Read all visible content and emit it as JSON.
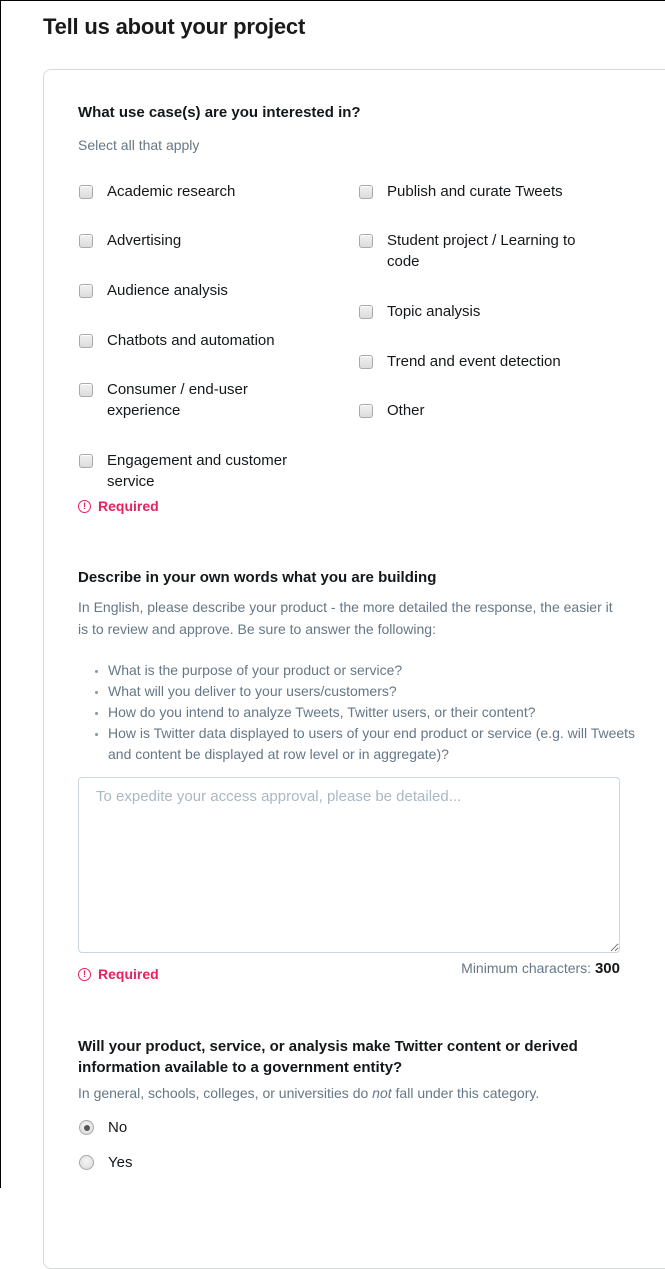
{
  "page": {
    "title": "Tell us about your project"
  },
  "use_cases": {
    "question": "What use case(s) are you interested in?",
    "hint": "Select all that apply",
    "left_options": [
      {
        "label": "Academic research",
        "checked": false
      },
      {
        "label": "Advertising",
        "checked": false
      },
      {
        "label": "Audience analysis",
        "checked": false
      },
      {
        "label": "Chatbots and automation",
        "checked": false
      },
      {
        "label": "Consumer / end-user experience",
        "checked": false
      },
      {
        "label": "Engagement and customer service",
        "checked": false
      }
    ],
    "right_options": [
      {
        "label": "Publish and curate Tweets",
        "checked": false
      },
      {
        "label": "Student project / Learning to code",
        "checked": false
      },
      {
        "label": "Topic analysis",
        "checked": false
      },
      {
        "label": "Trend and event detection",
        "checked": false
      },
      {
        "label": "Other",
        "checked": false
      }
    ],
    "error": "Required",
    "error_icon": "alert-circle-icon"
  },
  "description": {
    "question": "Describe in your own words what you are building",
    "hint": "In English, please describe your product - the more detailed the response, the easier it is to review and approve. Be sure to answer the following:",
    "bullets": [
      "What is the purpose of your product or service?",
      "What will you deliver to your users/customers?",
      "How do you intend to analyze Tweets, Twitter users, or their content?",
      "How is Twitter data displayed to users of your end product or service (e.g. will Tweets and content be displayed at row level or in aggregate)?"
    ],
    "placeholder": "To expedite your access approval, please be detailed...",
    "value": "",
    "error": "Required",
    "min_chars_label": "Minimum characters:",
    "min_chars_value": "300"
  },
  "government": {
    "question": "Will your product, service, or analysis make Twitter content or derived information available to a government entity?",
    "hint_before": "In general, schools, colleges, or universities do ",
    "hint_em": "not",
    "hint_after": " fall under this category.",
    "options": [
      {
        "label": "No",
        "checked": true
      },
      {
        "label": "Yes",
        "checked": false
      }
    ]
  },
  "colors": {
    "error": "#e0245e",
    "muted_text": "#657786",
    "primary_text": "#14171a",
    "border": "#d6dadd"
  }
}
